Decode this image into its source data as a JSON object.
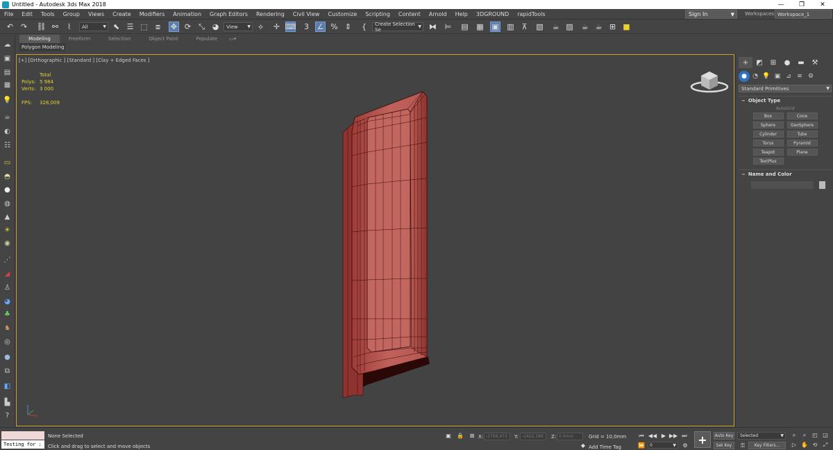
{
  "window": {
    "title": "Untitled - Autodesk 3ds Max 2018",
    "min": "—",
    "max": "❐",
    "close": "✕"
  },
  "menu": [
    "File",
    "Edit",
    "Tools",
    "Group",
    "Views",
    "Create",
    "Modifiers",
    "Animation",
    "Graph Editors",
    "Rendering",
    "Civil View",
    "Customize",
    "Scripting",
    "Content",
    "Arnold",
    "Help",
    "3DGROUND",
    "rapidTools"
  ],
  "signin": {
    "label": "Sign In",
    "arrow": "▼"
  },
  "workspace": {
    "label": "Workspaces:",
    "value": "Workspace_1"
  },
  "toolbar": {
    "filter": "All",
    "ref_coord": "View",
    "selection_set": "Create Selection Se",
    "dd_arrow": "▼"
  },
  "ribbon": {
    "tabs": [
      "Modeling",
      "Freeform",
      "Selection",
      "Object Paint",
      "Populate"
    ],
    "subtitle": "Polygon Modeling"
  },
  "viewport": {
    "label": "[+] [Orthographic ] [Standard ] [Clay + Edged Faces ]",
    "stats": {
      "header": "Total",
      "polys_label": "Polys:",
      "polys_value": "5 984",
      "verts_label": "Verts:",
      "verts_value": "3 000",
      "fps_label": "FPS:",
      "fps_value": "328,009"
    }
  },
  "command_panel": {
    "category": "Standard Primitives",
    "object_type_header": "Object Type",
    "autogrid": "AutoGrid",
    "object_buttons": [
      "Box",
      "Cone",
      "Sphere",
      "GeoSphere",
      "Cylinder",
      "Tube",
      "Torus",
      "Pyramid",
      "Teapot",
      "Plane",
      "TextPlus"
    ],
    "name_color_header": "Name and Color",
    "rollout_sign": "−"
  },
  "status": {
    "maxscript": "Testing for :",
    "selection": "None Selected",
    "prompt": "Click and drag to select and move objects",
    "x_label": "X:",
    "x_value": "-2766,473",
    "y_label": "Y:",
    "y_value": "-1422,186",
    "z_label": "Z:",
    "z_value": "0,0mm",
    "grid": "Grid = 10,0mm",
    "add_time_tag": "Add Time Tag",
    "frame": "0",
    "auto_key": "Auto Key",
    "set_key": "Set Key",
    "selected": "Selected",
    "key_filters": "Key Filters..."
  },
  "colors": {
    "viewport_border": "#c8a22a",
    "object": "#b5544d",
    "wire": "#3a0808",
    "active_tool": "#5a7dab",
    "stats_text": "#e8d030"
  }
}
